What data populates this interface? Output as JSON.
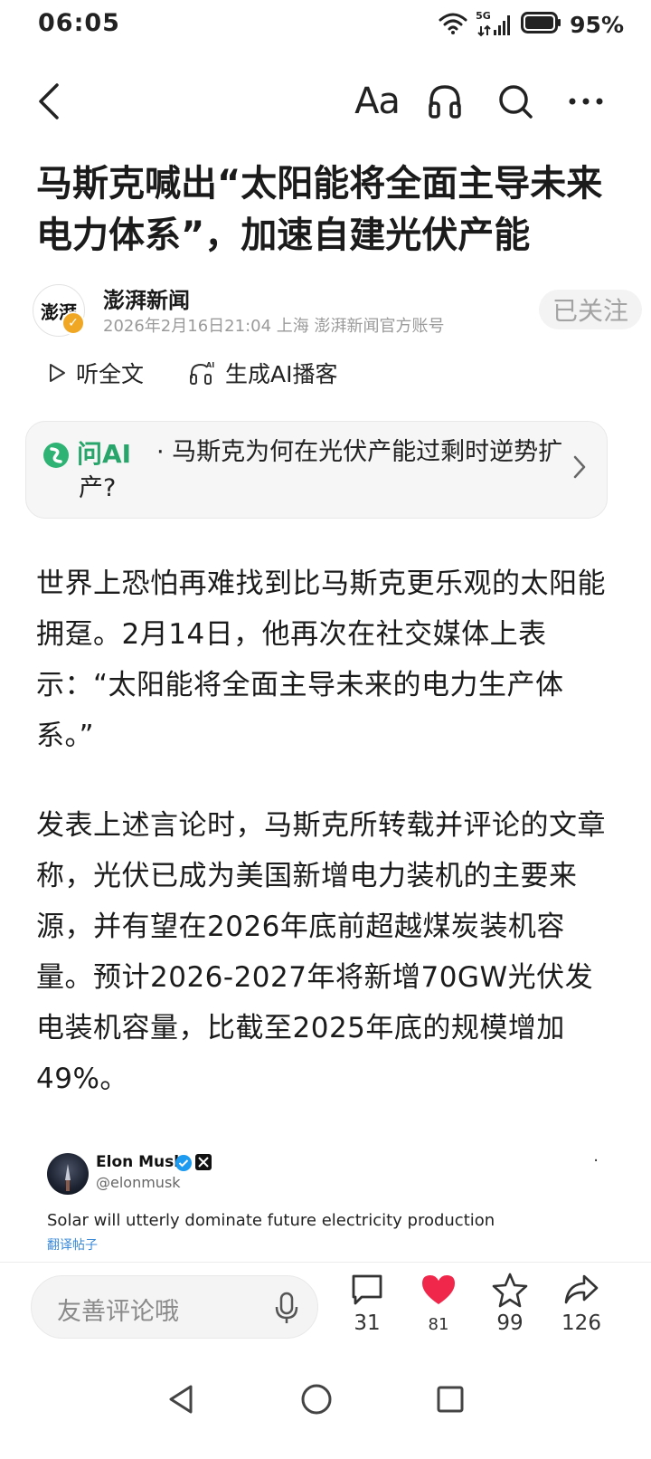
{
  "status_bar": {
    "time": "06:05",
    "network": "5G",
    "battery": "95%"
  },
  "toolbar": {
    "font_size_label": "Aa",
    "icons": [
      "back-icon",
      "headphones-icon",
      "search-icon",
      "more-icon"
    ]
  },
  "article": {
    "title": "马斯克喊出“太阳能将全面主导未来电力体系”，加速自建光伏产能",
    "author": {
      "avatar_text": "澎湃",
      "name": "澎湃新闻",
      "meta": "2026年2月16日21:04 上海 澎湃新闻官方账号",
      "follow_label": "已关注"
    },
    "listen_full": "听全文",
    "generate_podcast": "生成AI播客",
    "ask_ai": {
      "label": "问AI",
      "question": "· 马斯克为何在光伏产能过剩时逆势扩产?"
    },
    "paragraphs": [
      "世界上恐怕再难找到比马斯克更乐观的太阳能拥趸。2月14日，他再次在社交媒体上表示：“太阳能将全面主导未来的电力生产体系。”",
      "发表上述言论时，马斯克所转载并评论的文章称，光伏已成为美国新增电力装机的主要来源，并有望在2026年底前超越煤炭装机容量。预计2026-2027年将新增70GW光伏发电装机容量，比截至2025年底的规模增加49%。"
    ],
    "tweet": {
      "name": "Elon Musk",
      "handle": "@elonmusk",
      "text": "Solar will utterly dominate future electricity production",
      "translate_label": "翻译帖子"
    }
  },
  "bottom_bar": {
    "comment_placeholder": "友善评论哦",
    "comments": "31",
    "likes": "81",
    "favorites": "99",
    "shares": "126",
    "like_color": "#f0274a"
  },
  "colors": {
    "accent_green": "#27a56a",
    "badge_orange": "#f0a824",
    "link_blue": "#3a8ad8"
  }
}
